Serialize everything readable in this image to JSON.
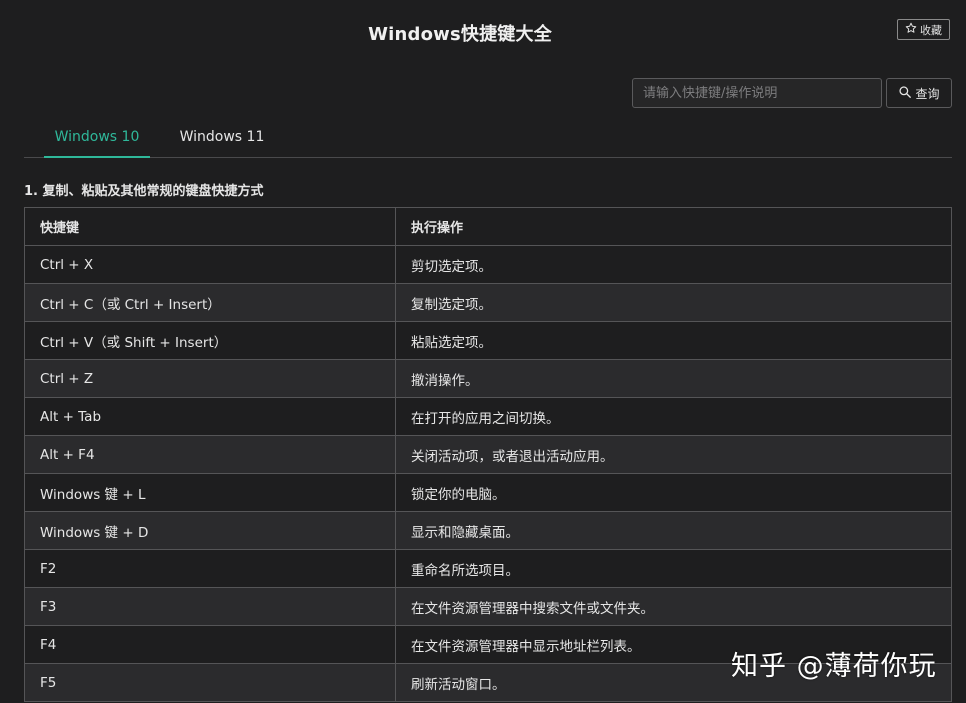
{
  "header": {
    "title": "Windows快捷键大全",
    "favorite_label": "收藏"
  },
  "search": {
    "placeholder": "请输入快捷键/操作说明",
    "value": "",
    "button_label": "查询"
  },
  "tabs": [
    {
      "label": "Windows 10",
      "active": true
    },
    {
      "label": "Windows 11",
      "active": false
    }
  ],
  "section": {
    "heading": "1. 复制、粘贴及其他常规的键盘快捷方式"
  },
  "table": {
    "headers": [
      "快捷键",
      "执行操作"
    ],
    "rows": [
      [
        "Ctrl + X",
        "剪切选定项。"
      ],
      [
        "Ctrl + C（或 Ctrl + Insert）",
        "复制选定项。"
      ],
      [
        "Ctrl + V（或 Shift + Insert）",
        "粘贴选定项。"
      ],
      [
        "Ctrl + Z",
        "撤消操作。"
      ],
      [
        "Alt + Tab",
        "在打开的应用之间切换。"
      ],
      [
        "Alt + F4",
        "关闭活动项，或者退出活动应用。"
      ],
      [
        "Windows 键 + L",
        "锁定你的电脑。"
      ],
      [
        "Windows 键 + D",
        "显示和隐藏桌面。"
      ],
      [
        "F2",
        "重命名所选项目。"
      ],
      [
        "F3",
        "在文件资源管理器中搜索文件或文件夹。"
      ],
      [
        "F4",
        "在文件资源管理器中显示地址栏列表。"
      ],
      [
        "F5",
        "刷新活动窗口。"
      ]
    ]
  },
  "watermark": "知乎 @薄荷你玩",
  "colors": {
    "background": "#1e1e1f",
    "accent": "#2fb89a",
    "row_alt": "#2b2b2d",
    "border": "#555557"
  },
  "icons": {
    "favorite": "star-icon",
    "search": "search-icon"
  }
}
